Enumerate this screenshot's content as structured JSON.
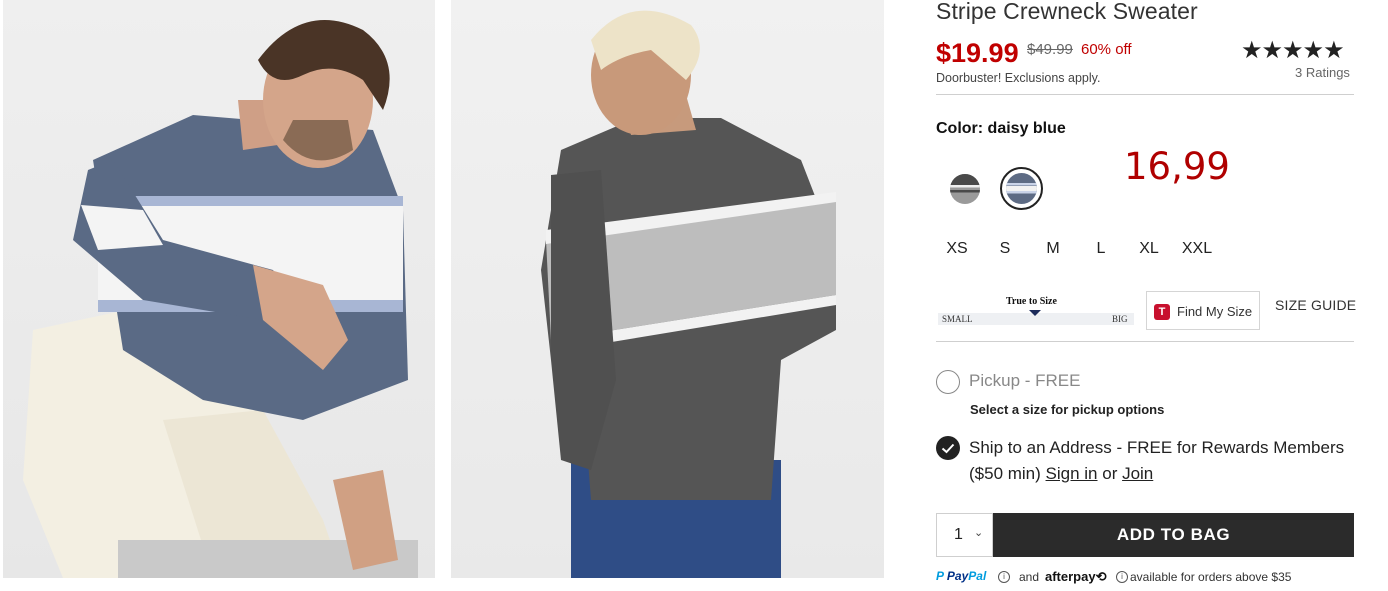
{
  "product": {
    "title": "Stripe Crewneck Sweater",
    "price": "$19.99",
    "original_price": "$49.99",
    "discount": "60% off",
    "promo_note": "Doorbuster! Exclusions apply.",
    "rating_stars": "★★★★★",
    "rating_value": 5,
    "ratings_count_label": "3 Ratings"
  },
  "color": {
    "label": "Color: daisy blue",
    "swatches": [
      {
        "name": "charcoal stripe",
        "selected": false
      },
      {
        "name": "daisy blue",
        "selected": true
      }
    ]
  },
  "annotation": {
    "handwritten_price": "16,99"
  },
  "sizes": [
    "XS",
    "S",
    "M",
    "L",
    "XL",
    "XXL"
  ],
  "fit_widget": {
    "title": "True to Size",
    "left_label": "SMALL",
    "right_label": "BIG"
  },
  "find_my_size": {
    "logo": "T",
    "label": "Find My Size"
  },
  "size_guide": "SIZE GUIDE",
  "fulfillment": {
    "pickup_label": "Pickup - FREE",
    "pickup_sub": "Select a size for pickup options",
    "pickup_selected": false,
    "ship_prefix": "Ship to an Address",
    "ship_dash": " - ",
    "ship_free": "FREE",
    "ship_rest": " for Rewards Members ($50 min) ",
    "sign_in": "Sign in",
    "or": " or ",
    "join": "Join",
    "ship_selected": true
  },
  "quantity": {
    "value": "1",
    "chevron": "⌄"
  },
  "add_to_bag": "ADD TO BAG",
  "payment": {
    "paypal_p": "P",
    "paypal_pay": "Pay",
    "paypal_pal": "Pal",
    "and": "and",
    "afterpay": "afterpay",
    "afterpay_mark": "⟲",
    "availability": "available for orders above $35",
    "info": "i"
  },
  "colors": {
    "price_red": "#c00000",
    "button_dark": "#2b2b2b",
    "handwritten_red": "#b00000"
  }
}
